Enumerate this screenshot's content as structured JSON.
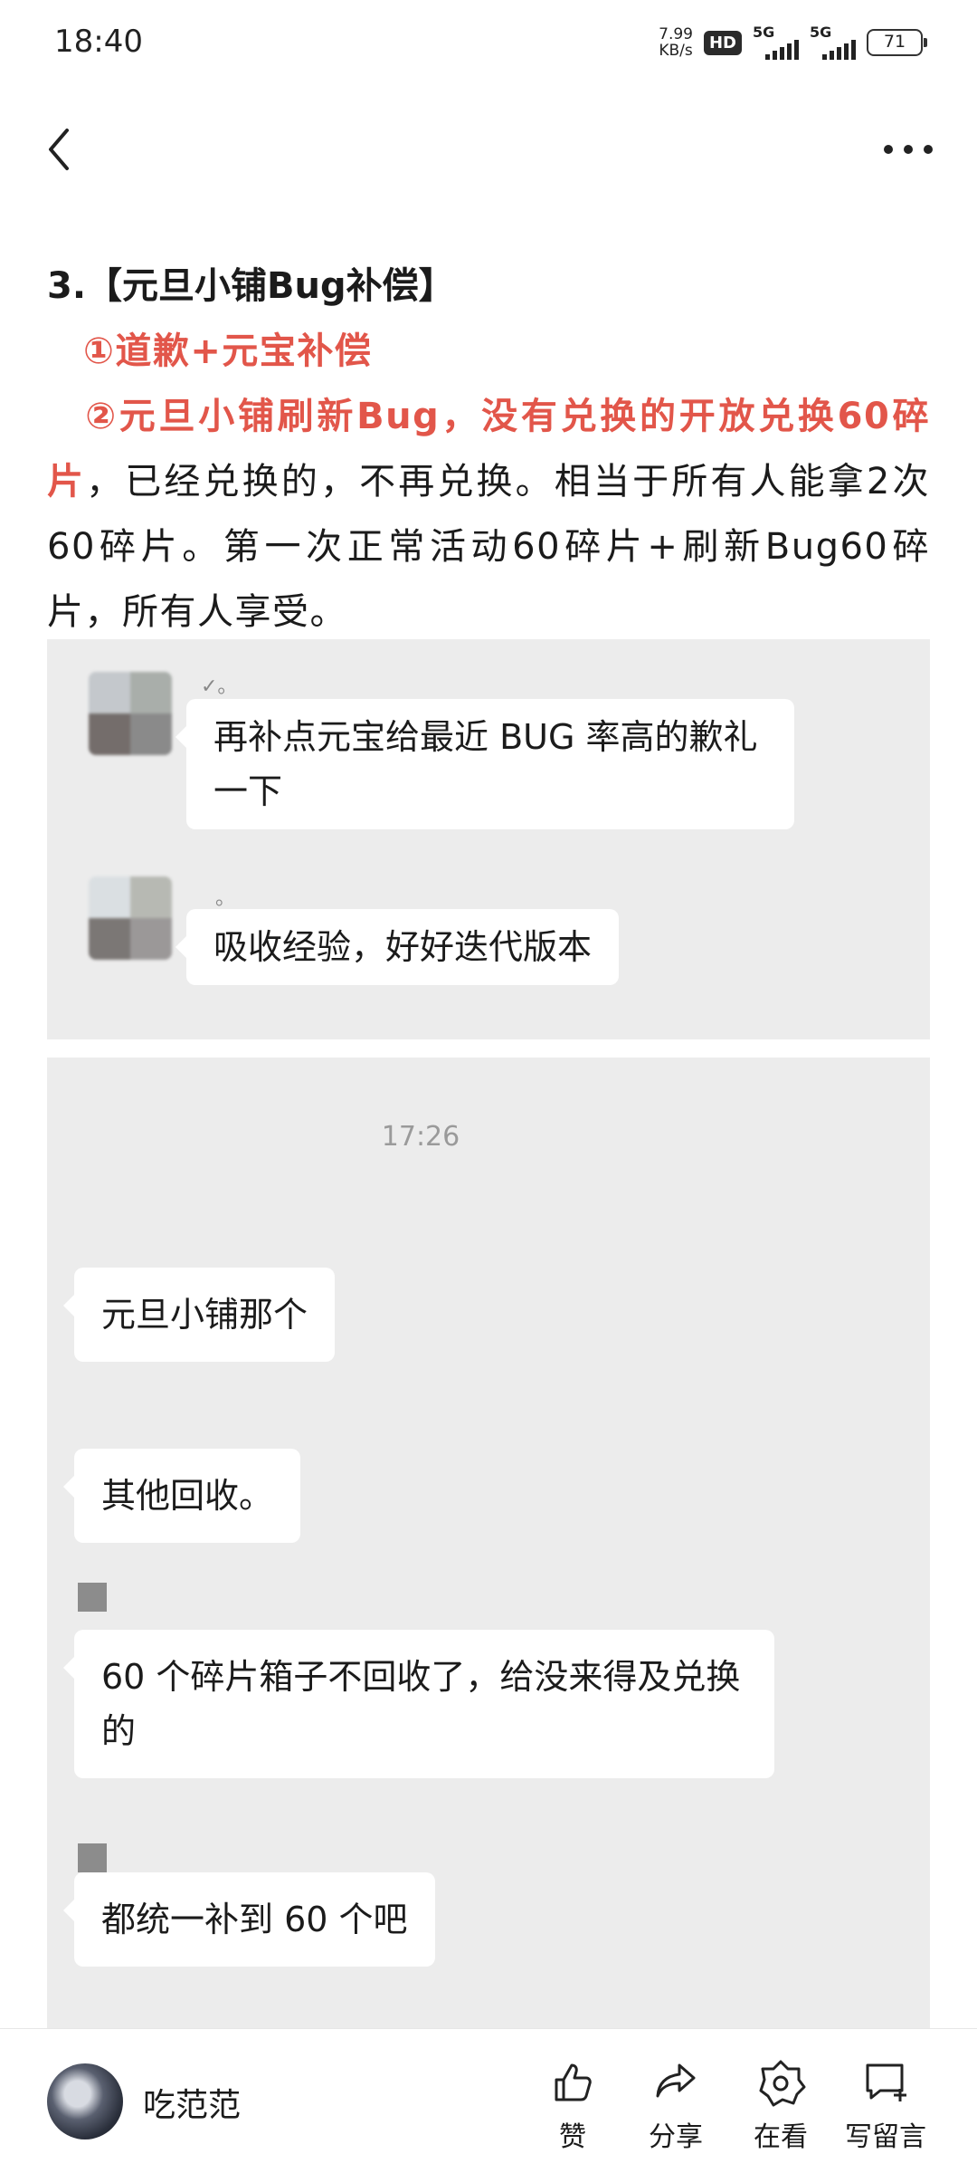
{
  "status_bar": {
    "time": "18:40",
    "net_speed_value": "7.99",
    "net_speed_unit": "KB/s",
    "hd_badge": "HD",
    "sim1": "5G",
    "sim2": "5G",
    "battery": "71"
  },
  "nav": {
    "back_icon": "chevron-left-icon",
    "more_icon": "more-horizontal-icon"
  },
  "article": {
    "heading": "3.【元旦小铺Bug补偿】",
    "item1": "①道歉+元宝补偿",
    "item2_highlight": "②元旦小铺刷新Bug，没有兑换的开放兑换60碎片",
    "item2_rest": "，已经兑换的，不再兑换。相当于所有人能拿2次60碎片。第一次正常活动60碎片+刷新Bug60碎片，所有人享受。"
  },
  "screenshot1": {
    "messages": [
      {
        "name": "✓。",
        "text": "再补点元宝给最近 BUG 率高的歉礼一下"
      },
      {
        "name": "。",
        "text": "吸收经验，好好迭代版本"
      }
    ]
  },
  "screenshot2": {
    "time": "17:26",
    "messages": [
      {
        "text": "元旦小铺那个"
      },
      {
        "text": "其他回收。"
      },
      {
        "text": "60 个碎片箱子不回收了，给没来得及兑换的"
      },
      {
        "text": "都统一补到 60 个吧"
      }
    ]
  },
  "bottom_bar": {
    "author_name": "吃范范",
    "actions": [
      {
        "label": "赞",
        "icon": "thumbs-up-icon"
      },
      {
        "label": "分享",
        "icon": "share-icon"
      },
      {
        "label": "在看",
        "icon": "star-flower-icon"
      },
      {
        "label": "写留言",
        "icon": "comment-plus-icon"
      }
    ]
  },
  "colors": {
    "highlight_red": "#e2564a",
    "chat_background": "#ececec",
    "bubble": "#ffffff",
    "timestamp": "#9a9a9a"
  }
}
